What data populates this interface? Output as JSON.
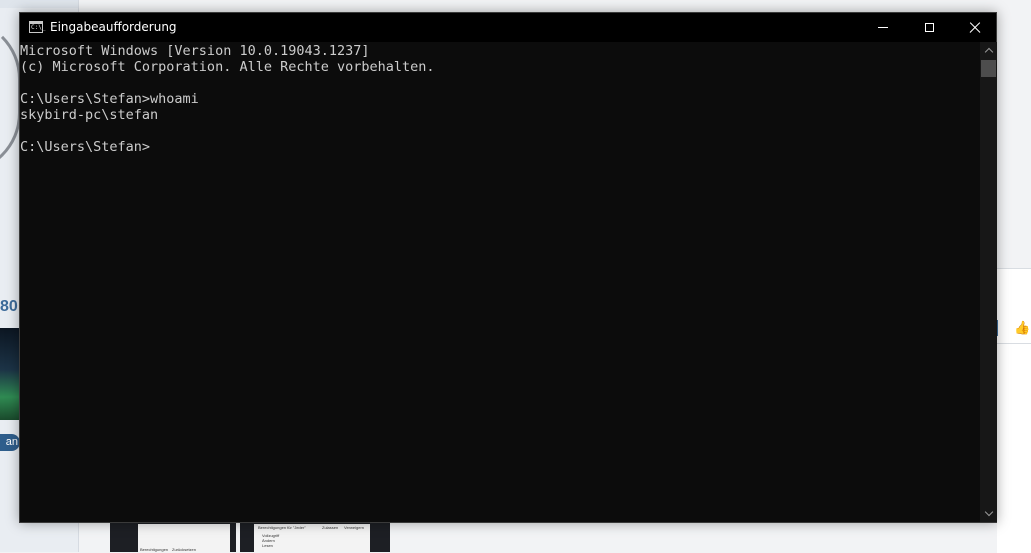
{
  "background": {
    "counter_fragment": "80",
    "tag_fragment": "an",
    "screenshot_labels": [
      "Berechtigungen für \"Jeder\"",
      "Zulassen",
      "Verweigern",
      "Vollzugriff",
      "Ändern",
      "Lesen",
      "Berechtigungen",
      "Zurücksetzen"
    ]
  },
  "window": {
    "title": "Eingabeaufforderung",
    "icon_glyph": "C:\\_",
    "buttons": {
      "minimize": "minimize",
      "maximize": "maximize",
      "close": "close"
    }
  },
  "console": {
    "lines": [
      "Microsoft Windows [Version 10.0.19043.1237]",
      "(c) Microsoft Corporation. Alle Rechte vorbehalten.",
      "",
      "C:\\Users\\Stefan>whoami",
      "skybird-pc\\stefan",
      "",
      "C:\\Users\\Stefan>"
    ],
    "text_color": "#cccccc",
    "background_color": "#0c0c0c"
  }
}
